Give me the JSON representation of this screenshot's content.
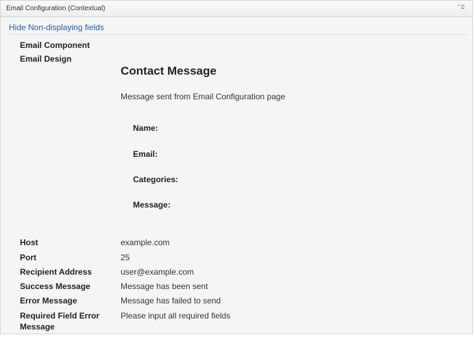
{
  "panel": {
    "title": "Email Configuration (Contextual)",
    "menu_icon": "dropdown-menu-icon"
  },
  "toggle_link": "Hide Non-displaying fields",
  "rows": {
    "email_component": "Email Component",
    "email_design": "Email Design",
    "host_label": "Host",
    "host_value": "example.com",
    "port_label": "Port",
    "port_value": "25",
    "recipient_label": "Recipient Address",
    "recipient_value": "user@example.com",
    "success_label": "Success Message",
    "success_value": "Message has been sent",
    "error_label": "Error Message",
    "error_value": "Message has failed to send",
    "required_label_line1": "Required Field Error",
    "required_label_line2": "Message",
    "required_value": "Please input all required fields"
  },
  "email_design": {
    "title": "Contact Message",
    "description": "Message sent from Email Configuration page",
    "fields": [
      "Name:",
      "Email:",
      "Categories:",
      "Message:"
    ]
  },
  "colors": {
    "link": "#1f5fa6",
    "panel_bg": "#f5f5f5",
    "border": "#d4d4d4"
  }
}
